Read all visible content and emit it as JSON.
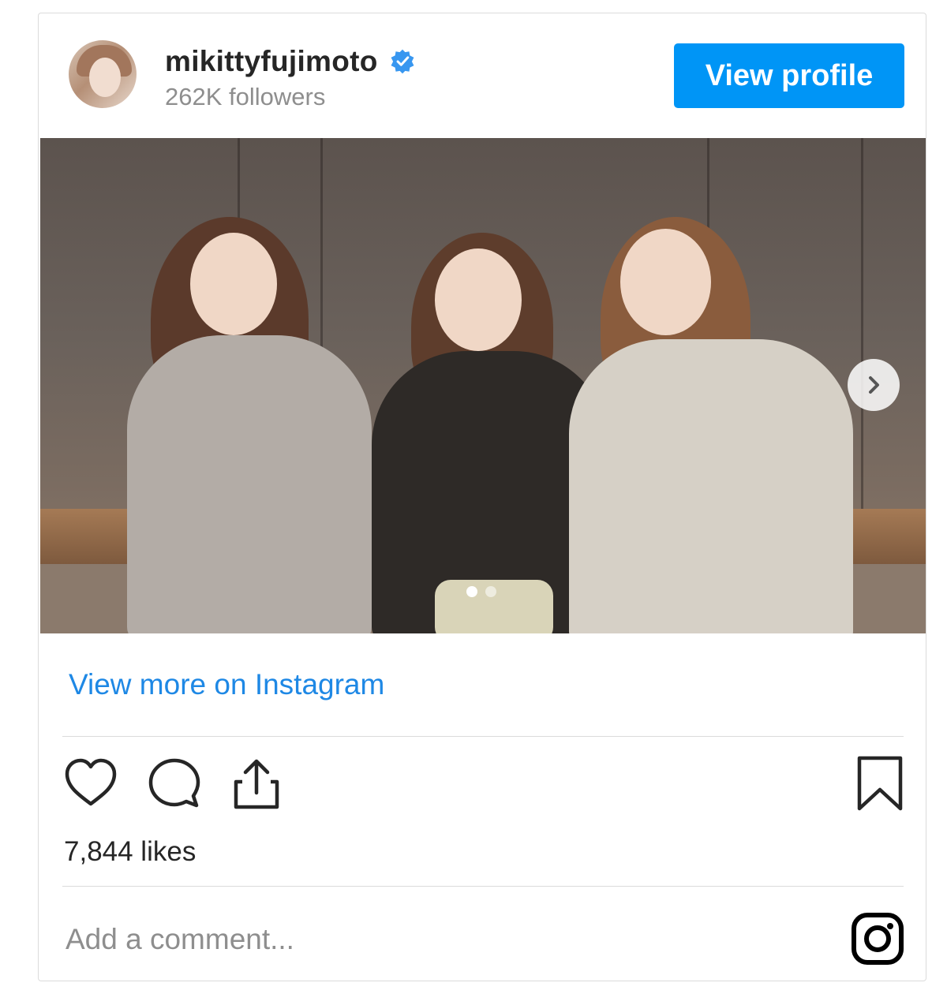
{
  "header": {
    "username": "mikittyfujimoto",
    "followers": "262K followers",
    "view_profile_label": "View profile",
    "verified_color": "#3897f0"
  },
  "post": {
    "image_alt": "",
    "carousel": {
      "total_slides": 2,
      "active_slide": 1
    }
  },
  "view_more_label": "View more on Instagram",
  "actions": {
    "icons": [
      "heart-icon",
      "comment-icon",
      "share-icon",
      "bookmark-icon"
    ]
  },
  "likes": "7,844 likes",
  "comment": {
    "placeholder": "Add a comment..."
  },
  "colors": {
    "accent": "#0095f6",
    "link": "#1e88e5",
    "muted": "#8e8e8e"
  }
}
